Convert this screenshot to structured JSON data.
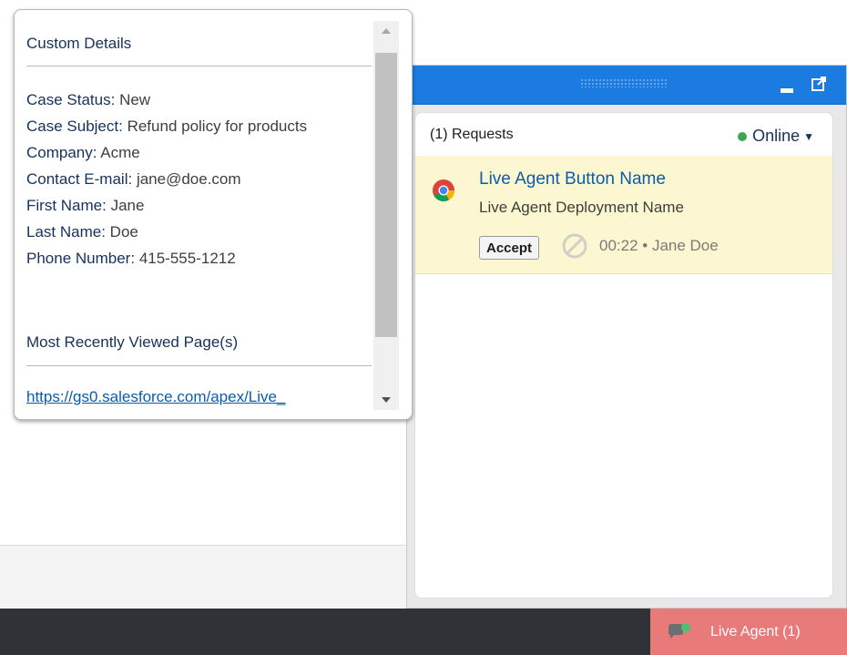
{
  "popover": {
    "title": "Custom Details",
    "fields": [
      {
        "label": "Case Status:",
        "value": "New"
      },
      {
        "label": "Case Subject:",
        "value": "Refund policy for products"
      },
      {
        "label": "Company:",
        "value": "Acme"
      },
      {
        "label": "Contact E-mail:",
        "value": "jane@doe.com"
      },
      {
        "label": "First Name:",
        "value": "Jane"
      },
      {
        "label": "Last Name:",
        "value": "Doe"
      },
      {
        "label": "Phone Number:",
        "value": "415-555-1212"
      }
    ],
    "pages_title": "Most Recently Viewed Page(s)",
    "page_link": "https://gs0.salesforce.com/apex/Live_"
  },
  "panel": {
    "requests_label": "(1) Requests",
    "status_label": "Online",
    "status_color": "#3ba755",
    "header_color": "#1b7be0",
    "request": {
      "title": "Live Agent Button Name",
      "deployment": "Live Agent Deployment Name",
      "accept_label": "Accept",
      "meta": "00:22 • Jane Doe",
      "browser_icon": "chrome-icon"
    }
  },
  "utility_bar": {
    "tab_label": "Live Agent (1)",
    "tab_color": "#e87b7a",
    "tab_icon": "chat-icon"
  }
}
